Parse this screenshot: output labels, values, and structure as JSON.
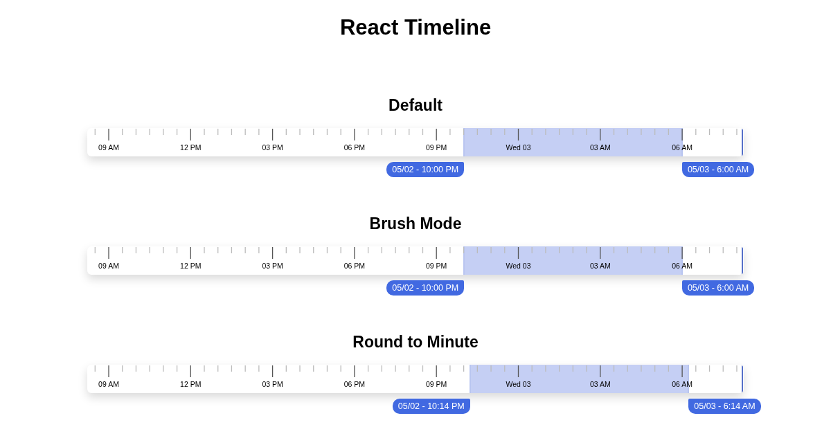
{
  "title": "React Timeline",
  "timelines": [
    {
      "title": "Default",
      "axis_labels": [
        "09 AM",
        "12 PM",
        "03 PM",
        "06 PM",
        "09 PM",
        "Wed 03",
        "03 AM",
        "06 AM"
      ],
      "selection": {
        "start": {
          "level": 0.574,
          "label": "05/02 - 10:00 PM"
        },
        "end": {
          "level": 0.906,
          "label": "05/03 - 6:00 AM"
        }
      }
    },
    {
      "title": "Brush Mode",
      "axis_labels": [
        "09 AM",
        "12 PM",
        "03 PM",
        "06 PM",
        "09 PM",
        "Wed 03",
        "03 AM",
        "06 AM"
      ],
      "selection": {
        "start": {
          "level": 0.574,
          "label": "05/02 - 10:00 PM"
        },
        "end": {
          "level": 0.906,
          "label": "05/03 - 6:00 AM"
        }
      }
    },
    {
      "title": "Round to Minute",
      "axis_labels": [
        "09 AM",
        "12 PM",
        "03 PM",
        "06 PM",
        "09 PM",
        "Wed 03",
        "03 AM",
        "06 AM"
      ],
      "selection": {
        "start": {
          "level": 0.583,
          "label": "05/02 - 10:14 PM"
        },
        "end": {
          "level": 0.916,
          "label": "05/03 - 6:14 AM"
        }
      }
    }
  ]
}
